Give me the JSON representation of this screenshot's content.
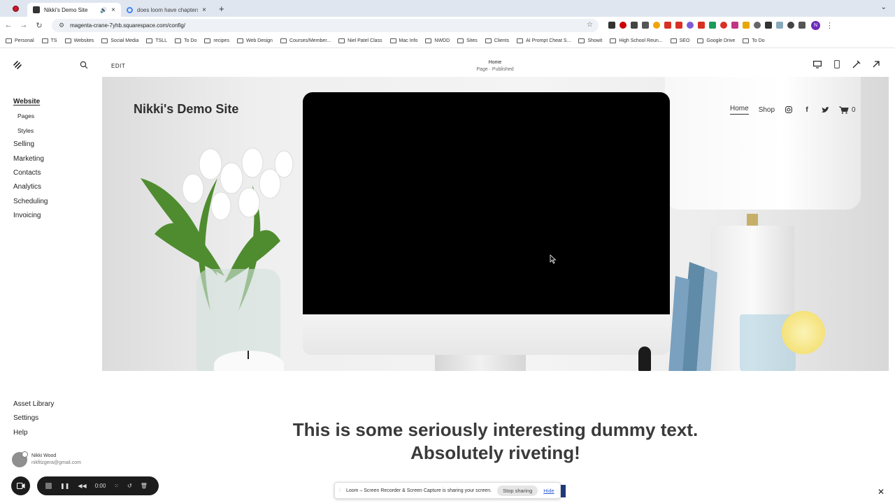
{
  "browser": {
    "tabs": [
      {
        "title": "Nikki's Demo Site",
        "active": true
      },
      {
        "title": "does loom have chapters - G",
        "active": false
      }
    ],
    "url": "magenta-crane-7yhb.squarespace.com/config/",
    "profile_initial": "N",
    "extension_colors": [
      "#333333",
      "#cc0000",
      "#444444",
      "#555555",
      "#f0a500",
      "#d93025",
      "#d93025",
      "#7b5cd6",
      "#d93025",
      "#1a9c5a",
      "#d93025",
      "#c13584",
      "#e8a600",
      "#666666",
      "#333333",
      "#8ab",
      "#444444",
      "#555555"
    ],
    "bookmarks": [
      "Personal",
      "TS",
      "Websites",
      "Social Media",
      "TSLL",
      "To Do",
      "recipes",
      "Web Design",
      "Courses/Member...",
      "Niel Patel Class",
      "Mac Info",
      "NWDD",
      "Sites",
      "Clients",
      "AI Prompt Cheat S...",
      "Showit",
      "High School Reun...",
      "SEO",
      "Google Drive",
      "To Do"
    ]
  },
  "sidebar": {
    "items": [
      {
        "label": "Website",
        "active": true
      },
      {
        "label": "Pages",
        "sub": true
      },
      {
        "label": "Styles",
        "sub": true
      },
      {
        "label": "Selling"
      },
      {
        "label": "Marketing"
      },
      {
        "label": "Contacts"
      },
      {
        "label": "Analytics"
      },
      {
        "label": "Scheduling"
      },
      {
        "label": "Invoicing"
      }
    ],
    "bottom": [
      "Asset Library",
      "Settings",
      "Help"
    ],
    "user": {
      "name": "Nikki Wood",
      "email": "nikfitzgera@gmail.com"
    }
  },
  "editor": {
    "edit_label": "EDIT",
    "page_title": "Home",
    "page_status": "Page · Published"
  },
  "site": {
    "title": "Nikki's Demo Site",
    "nav": [
      "Home",
      "Shop"
    ],
    "cart_count": "0",
    "body_line1": "This is some seriously interesting dummy text.",
    "body_line2": "Absolutely riveting!"
  },
  "loom": {
    "timer": "0:00",
    "sharing_message": "Loom – Screen Recorder & Screen Capture is sharing your screen.",
    "stop_label": "Stop sharing",
    "hide_label": "Hide"
  }
}
